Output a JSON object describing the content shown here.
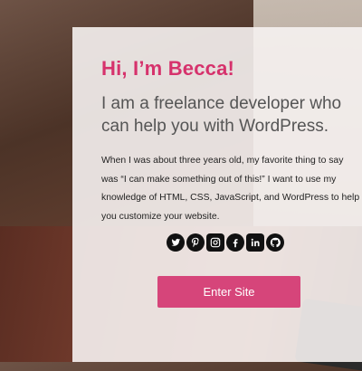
{
  "hero": {
    "greeting": "Hi, I’m Becca!",
    "tagline": "I am a freelance developer who can help you with WordPress.",
    "bio": "When I was about three years old, my favorite thing to say was “I can make something out of this!” I want to use my knowledge of HTML, CSS, JavaScript, and WordPress to help you customize your website.",
    "enter_label": "Enter Site"
  },
  "social": {
    "icons": [
      "twitter-icon",
      "pinterest-icon",
      "instagram-icon",
      "facebook-icon",
      "linkedin-icon",
      "github-icon"
    ]
  },
  "colors": {
    "accent": "#d6326c",
    "button": "#d6457a"
  }
}
